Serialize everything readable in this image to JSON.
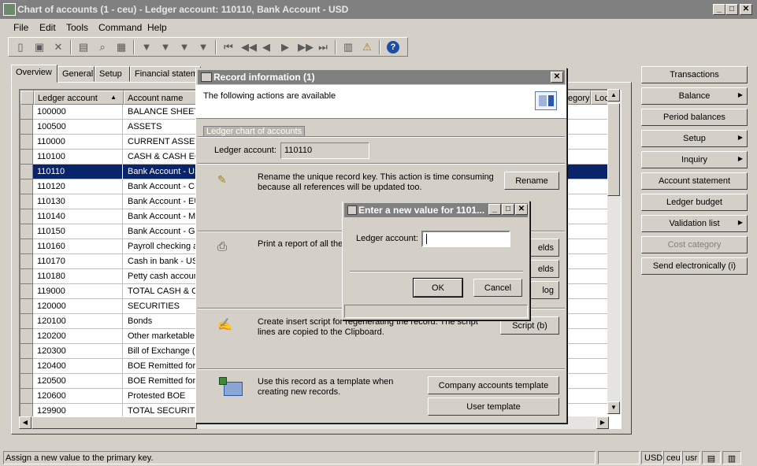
{
  "window": {
    "title": "Chart of accounts (1 - ceu) - Ledger account: 110110, Bank Account - USD",
    "minimize": "_",
    "maximize": "□",
    "close": "✕"
  },
  "menu": {
    "file": "File",
    "edit": "Edit",
    "tools": "Tools",
    "command": "Command",
    "help": "Help"
  },
  "toolbar_icons": [
    "new-icon",
    "save-icon",
    "delete-icon",
    "print-icon",
    "print-preview-icon",
    "export-icon",
    "filter-icon",
    "filter-by-selection-icon",
    "advanced-filter-icon",
    "remove-filter-icon",
    "first-record-icon",
    "previous-page-icon",
    "previous-record-icon",
    "next-record-icon",
    "next-page-icon",
    "last-record-icon",
    "clipboard-icon",
    "alert-icon",
    "help-icon"
  ],
  "tabs": [
    "Overview",
    "General",
    "Setup",
    "Financial statem"
  ],
  "grid": {
    "col_account": "Ledger account",
    "col_name": "Account name",
    "col_category": "egory",
    "col_lock": "Lock",
    "rows": [
      {
        "account": "100000",
        "name": "BALANCE SHEET"
      },
      {
        "account": "100500",
        "name": "ASSETS"
      },
      {
        "account": "110000",
        "name": "CURRENT ASSETS"
      },
      {
        "account": "110100",
        "name": "CASH & CASH EQU"
      },
      {
        "account": "110110",
        "name": "Bank Account - US"
      },
      {
        "account": "110120",
        "name": "Bank Account - CN"
      },
      {
        "account": "110130",
        "name": "Bank Account - EU"
      },
      {
        "account": "110140",
        "name": "Bank Account - MX"
      },
      {
        "account": "110150",
        "name": "Bank Account - GB"
      },
      {
        "account": "110160",
        "name": "Payroll checking a"
      },
      {
        "account": "110170",
        "name": "Cash in bank - US"
      },
      {
        "account": "110180",
        "name": "Petty cash accoun"
      },
      {
        "account": "119000",
        "name": "TOTAL CASH & CA"
      },
      {
        "account": "120000",
        "name": "SECURITIES"
      },
      {
        "account": "120100",
        "name": "Bonds"
      },
      {
        "account": "120200",
        "name": "Other marketable"
      },
      {
        "account": "120300",
        "name": "Bill of Exchange (B"
      },
      {
        "account": "120400",
        "name": "BOE Remitted for"
      },
      {
        "account": "120500",
        "name": "BOE Remitted for"
      },
      {
        "account": "120600",
        "name": "Protested BOE"
      },
      {
        "account": "129900",
        "name": "TOTAL SECURITIE"
      }
    ]
  },
  "right_buttons": {
    "transactions": "Transactions",
    "balance": "Balance",
    "period_balances": "Period balances",
    "setup": "Setup",
    "inquiry": "Inquiry",
    "account_statement": "Account statement",
    "ledger_budget": "Ledger budget",
    "validation_list": "Validation list",
    "cost_category": "Cost category",
    "send_electronically": "Send electronically (i)"
  },
  "record_info": {
    "title": "Record information (1)",
    "intro": "The following actions are available",
    "group_label": "Ledger chart of accounts",
    "ledger_label": "Ledger account:",
    "ledger_value": "110110",
    "rename_desc": "Rename the unique record key. This action is time consuming because all references will be updated too.",
    "rename_btn": "Rename",
    "print_desc": "Print a report of all the",
    "fields_btn_1": "elds",
    "fields_btn_2": "elds",
    "log_btn": "log",
    "script_desc": "Create insert script for regenerating the record. The script lines are copied to the Clipboard.",
    "script_btn": "Script (b)",
    "template_desc": "Use this record as a template when creating new records.",
    "company_template_btn": "Company accounts template",
    "user_template_btn": "User template"
  },
  "new_value_dialog": {
    "title": "Enter a new value for 1101...",
    "label": "Ledger account:",
    "value": "",
    "ok": "OK",
    "cancel": "Cancel"
  },
  "status": {
    "text": "Assign a new value to the primary key.",
    "currency": "USD",
    "company": "ceu",
    "user": "usr"
  }
}
